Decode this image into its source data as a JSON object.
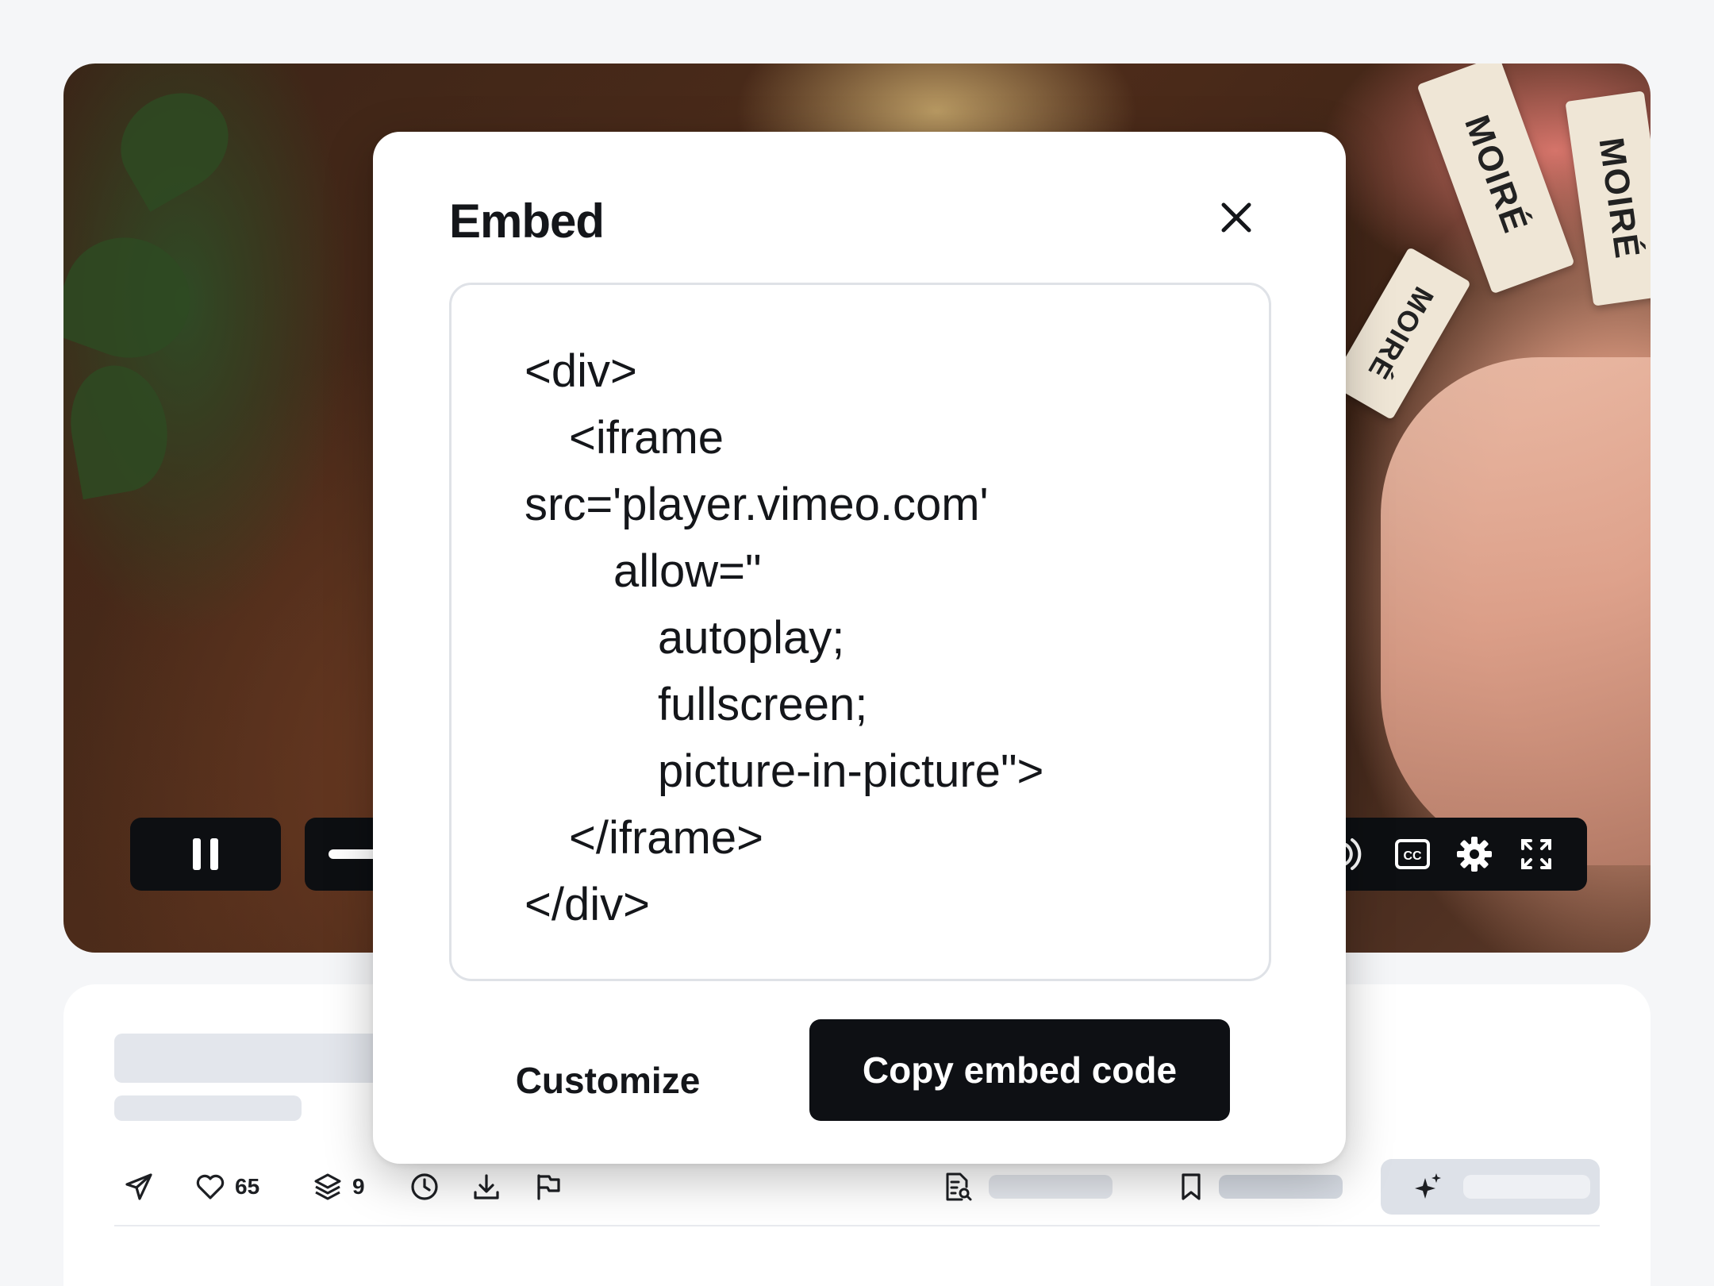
{
  "modal": {
    "title": "Embed",
    "code_lines": [
      "<div>",
      "<iframe",
      "src='player.vimeo.com'",
      "allow=\"",
      "autoplay;",
      "fullscreen;",
      "picture-in-picture\">",
      "</iframe>",
      "</div>"
    ],
    "customize_label": "Customize",
    "copy_label": "Copy embed code"
  },
  "player": {
    "ribbon_texts": [
      "MOIRÉ",
      "MOIRÉ",
      "MOIRÉ"
    ],
    "controls": {
      "left_icon": "pause-icon",
      "right_icons": [
        "volume-icon",
        "captions-icon",
        "settings-icon",
        "fullscreen-icon"
      ],
      "captions_label": "CC"
    }
  },
  "toolbar": {
    "likes_count": "65",
    "collections_count": "9",
    "icons": [
      "send-icon",
      "heart-icon",
      "layers-icon",
      "clock-icon",
      "download-icon",
      "flag-icon",
      "transcript-icon",
      "bookmark-icon",
      "sparkle-icon"
    ]
  },
  "colors": {
    "background": "#f5f6f8",
    "primary_button": "#0e1014",
    "skeleton": "#e3e6ec",
    "ai_button": "#dde1e8"
  }
}
